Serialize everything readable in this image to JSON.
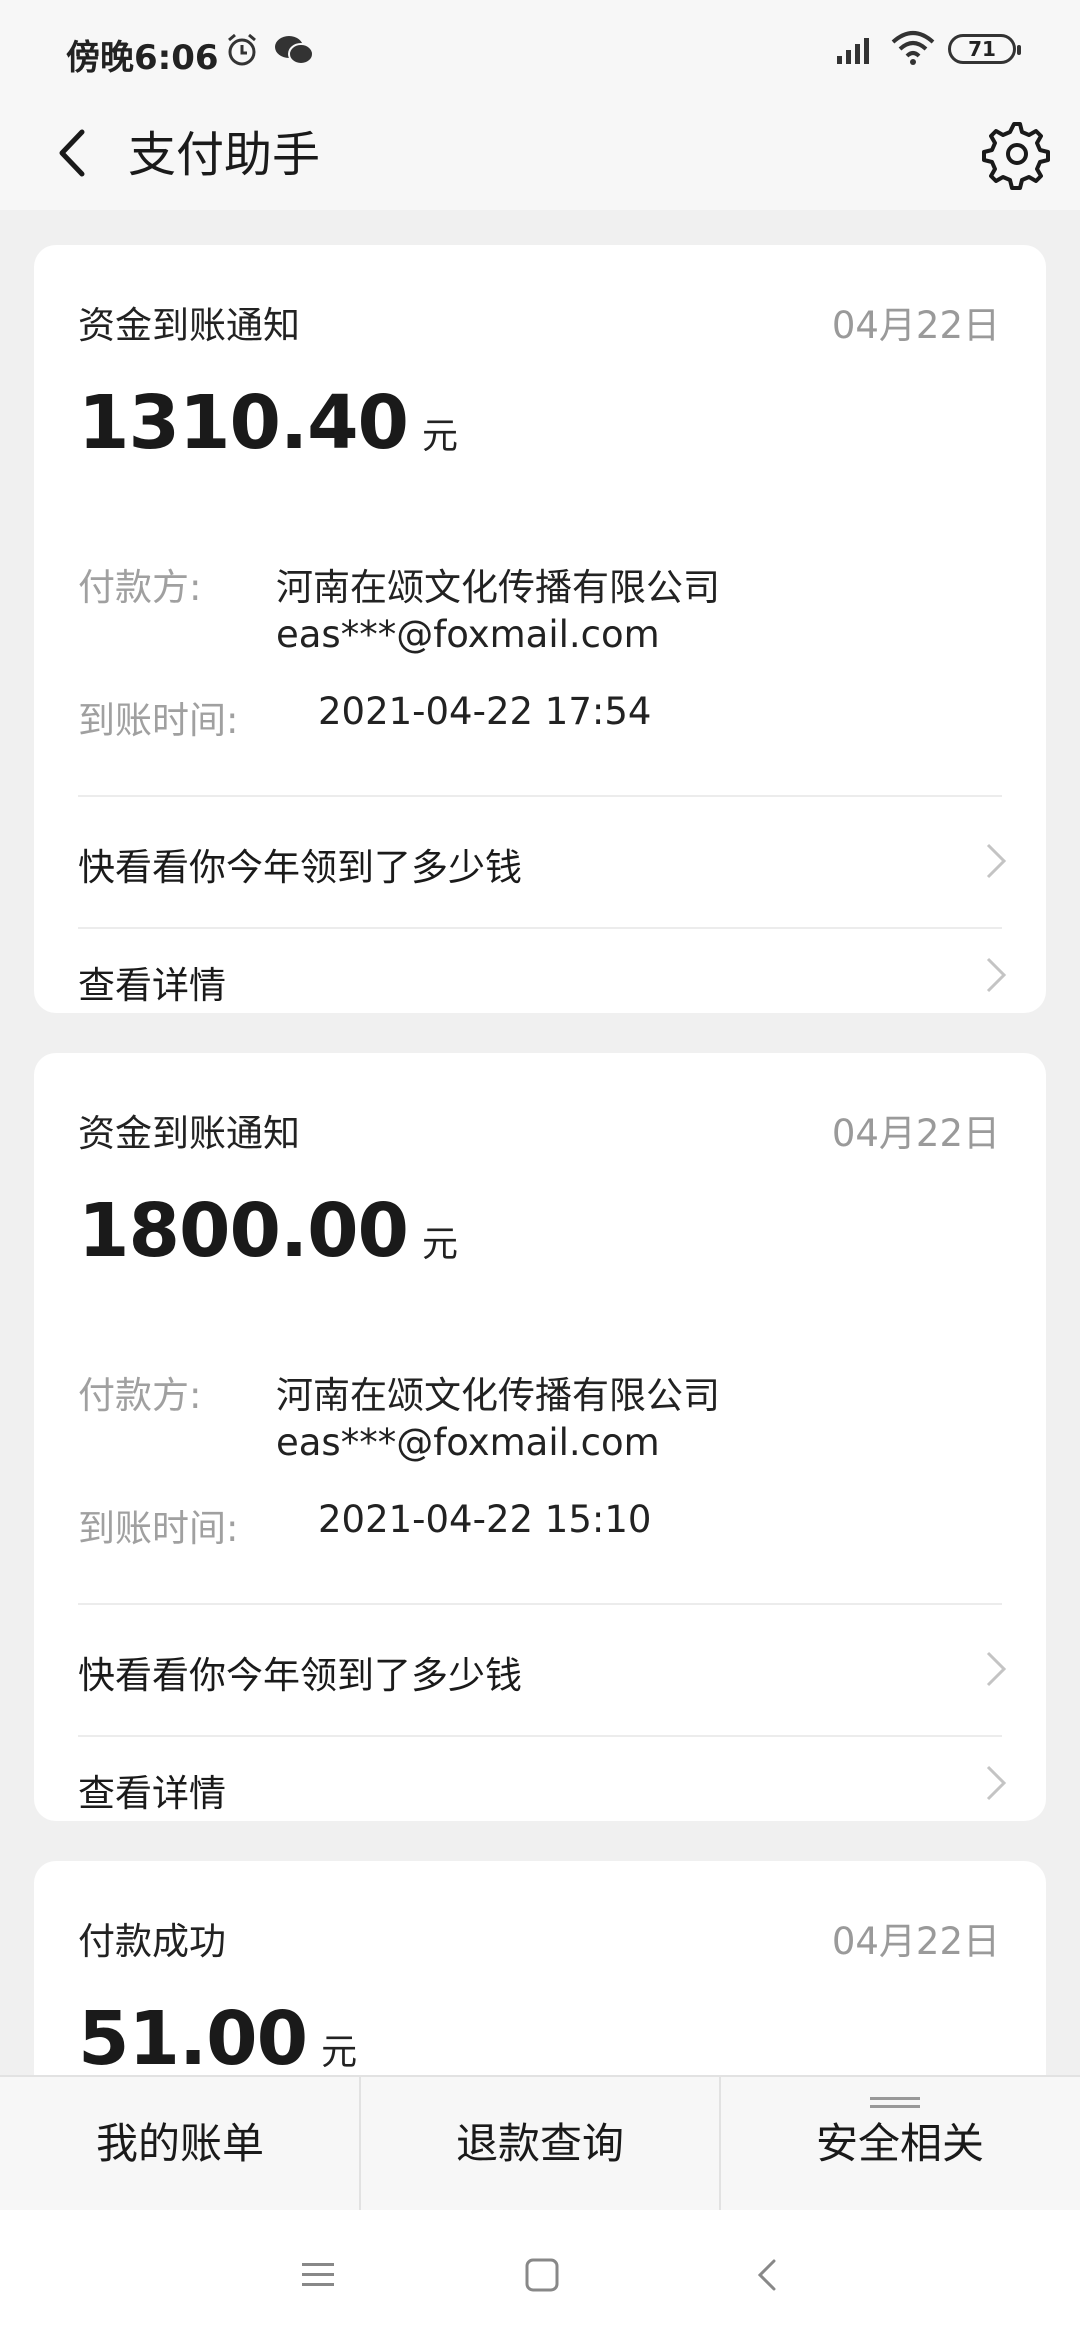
{
  "status_bar": {
    "time": "傍晚6:06",
    "battery": "71"
  },
  "header": {
    "title": "支付助手"
  },
  "cards": [
    {
      "type": "资金到账通知",
      "date": "04月22日",
      "amount": "1310.40",
      "unit": "元",
      "payer_label": "付款方:",
      "payer_name": "河南在颂文化传播有限公司",
      "payer_account": "eas***@foxmail.com",
      "time_label": "到账时间:",
      "time_value": "2021-04-22 17:54",
      "links": [
        "快看看你今年领到了多少钱",
        "查看详情"
      ]
    },
    {
      "type": "资金到账通知",
      "date": "04月22日",
      "amount": "1800.00",
      "unit": "元",
      "payer_label": "付款方:",
      "payer_name": "河南在颂文化传播有限公司",
      "payer_account": "eas***@foxmail.com",
      "time_label": "到账时间:",
      "time_value": "2021-04-22 15:10",
      "links": [
        "快看看你今年领到了多少钱",
        "查看详情"
      ]
    },
    {
      "type": "付款成功",
      "date": "04月22日",
      "amount": "51.00",
      "unit": "元"
    }
  ],
  "tabs": [
    "我的账单",
    "退款查询",
    "安全相关"
  ],
  "colors": {
    "background": "#f0f0f0",
    "card": "#ffffff",
    "muted_text": "#9a9a9a"
  }
}
